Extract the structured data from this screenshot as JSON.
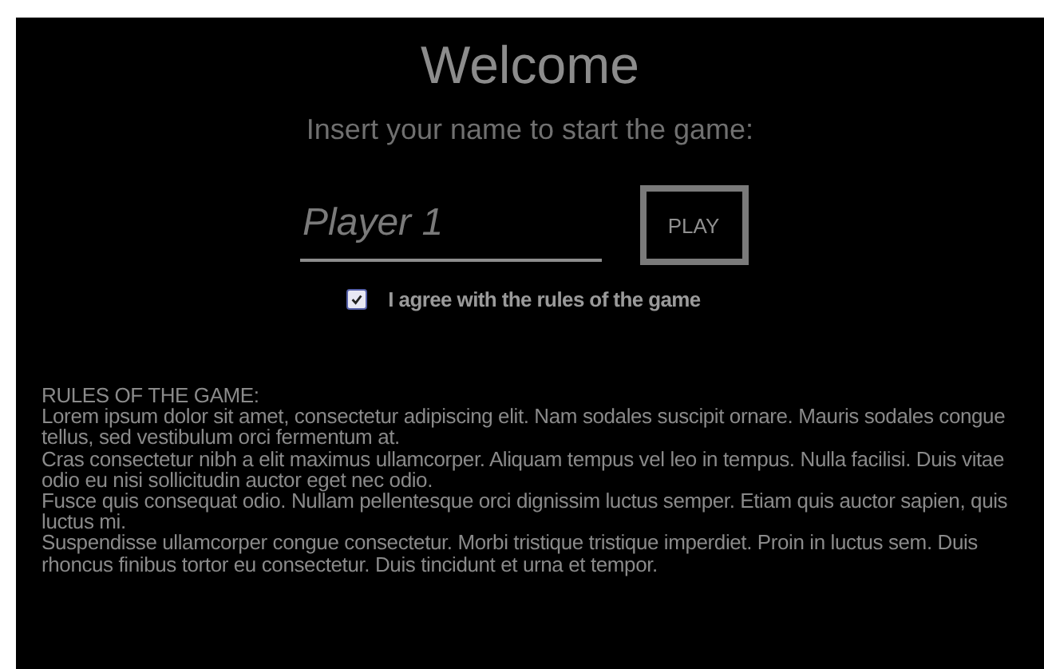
{
  "title": "Welcome",
  "subtitle": "Insert your name to start the game:",
  "name_field": {
    "placeholder": "Player 1"
  },
  "play_button": "PLAY",
  "agree": {
    "label": "I agree with the rules of the game",
    "checked": true
  },
  "rules": {
    "heading": "RULES OF THE GAME:",
    "paragraphs": [
      "Lorem ipsum dolor sit amet, consectetur adipiscing elit. Nam sodales suscipit ornare. Mauris sodales congue tellus, sed vestibulum orci fermentum at.",
      "Cras consectetur nibh a elit maximus ullamcorper. Aliquam tempus vel leo in tempus. Nulla facilisi. Duis vitae odio eu nisi sollicitudin auctor eget nec odio.",
      "Fusce quis consequat odio. Nullam pellentesque orci dignissim luctus semper. Etiam quis auctor sapien, quis luctus mi.",
      "Suspendisse ullamcorper congue consectetur. Morbi tristique tristique imperdiet. Proin in luctus sem. Duis rhoncus finibus tortor eu consectetur. Duis tincidunt et urna et tempor."
    ]
  }
}
